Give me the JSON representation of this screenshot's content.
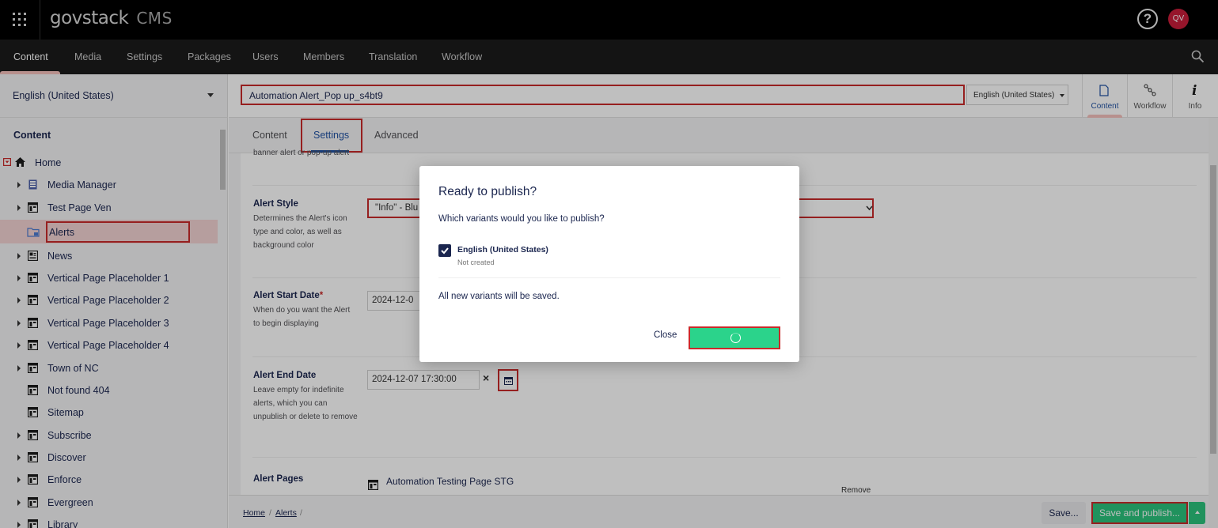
{
  "app": {
    "brand": "govstack",
    "product": "CMS",
    "avatar_initials": "QV",
    "help": "?"
  },
  "sections": [
    "Content",
    "Media",
    "Settings",
    "Packages",
    "Users",
    "Members",
    "Translation",
    "Workflow"
  ],
  "sidebar": {
    "language": "English (United States)",
    "tree_title": "Content",
    "items": [
      {
        "label": "Home"
      },
      {
        "label": "Media Manager"
      },
      {
        "label": "Test Page Ven"
      },
      {
        "label": "Alerts"
      },
      {
        "label": "News"
      },
      {
        "label": "Vertical Page Placeholder 1"
      },
      {
        "label": "Vertical Page Placeholder 2"
      },
      {
        "label": "Vertical Page Placeholder 3"
      },
      {
        "label": "Vertical Page Placeholder 4"
      },
      {
        "label": "Town of NC"
      },
      {
        "label": "Not found 404"
      },
      {
        "label": "Sitemap"
      },
      {
        "label": "Subscribe"
      },
      {
        "label": "Discover"
      },
      {
        "label": "Enforce"
      },
      {
        "label": "Evergreen"
      },
      {
        "label": "Library"
      }
    ]
  },
  "editor": {
    "node_name": "Automation Alert_Pop up_s4bt9",
    "variant": "English (United States)",
    "apps": [
      "Content",
      "Workflow",
      "Info"
    ],
    "tabs": [
      "Content",
      "Settings",
      "Advanced"
    ],
    "cut_text": "banner alert or pop-up alert",
    "alert_style": {
      "title": "Alert Style",
      "desc": "Determines the Alert's icon type and color, as well as background color",
      "value": "\"Info\" - Blu"
    },
    "alert_start": {
      "title": "Alert Start Date",
      "required": "*",
      "desc": "When do you want the Alert to begin displaying",
      "value": "2024-12-0"
    },
    "alert_end": {
      "title": "Alert End Date",
      "desc": "Leave empty for indefinite alerts, which you can unpublish or delete to remove",
      "value": "2024-12-07 17:30:00",
      "clear": "×"
    },
    "alert_pages": {
      "title": "Alert Pages",
      "page": "Automation Testing Page STG",
      "remove": "Remove"
    }
  },
  "footer": {
    "breadcrumb": [
      "Home",
      "Alerts"
    ],
    "sep": "/",
    "save": "Save...",
    "publish": "Save and publish..."
  },
  "modal": {
    "title": "Ready to publish?",
    "question": "Which variants would you like to publish?",
    "variant_name": "English (United States)",
    "variant_status": "Not created",
    "note": "All new variants will be saved.",
    "close": "Close"
  }
}
